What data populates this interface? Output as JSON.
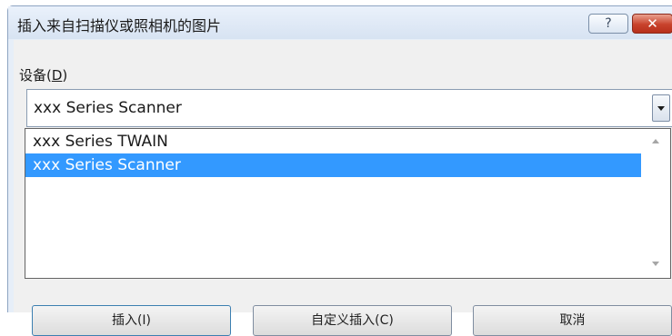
{
  "window": {
    "title": "插入来自扫描仪或照相机的图片",
    "help_label": "?",
    "close_label": "✕"
  },
  "device": {
    "label_prefix": "设备(",
    "label_mnemonic": "D",
    "label_suffix": ")",
    "selected_value": "xxx  Series Scanner",
    "options": [
      {
        "label": "xxx  Series TWAIN",
        "selected": false
      },
      {
        "label": "xxx  Series Scanner",
        "selected": true
      }
    ]
  },
  "buttons": {
    "insert_label": "插入(I)",
    "custom_insert_label": "自定义插入(C)",
    "cancel_label": "取消"
  },
  "colors": {
    "selection": "#3399ff",
    "close_button": "#c8422c"
  }
}
